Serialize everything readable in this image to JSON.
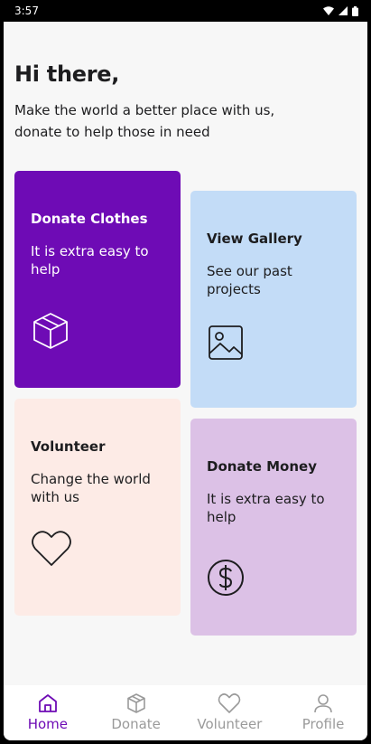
{
  "status_bar": {
    "time": "3:57"
  },
  "header": {
    "greeting": "Hi there,",
    "subtitle": "Make the world a better place with us, donate to help those in need"
  },
  "cards": {
    "donate_clothes": {
      "title": "Donate Clothes",
      "description": "It is extra easy to help",
      "icon": "box-icon"
    },
    "view_gallery": {
      "title": "View Gallery",
      "description": "See our past projects",
      "icon": "image-icon"
    },
    "volunteer": {
      "title": "Volunteer",
      "description": "Change the world with us",
      "icon": "heart-icon"
    },
    "donate_money": {
      "title": "Donate Money",
      "description": "It is extra easy to help",
      "icon": "dollar-icon"
    }
  },
  "bottom_nav": {
    "items": [
      {
        "label": "Home",
        "icon": "home-icon",
        "active": true
      },
      {
        "label": "Donate",
        "icon": "box-icon",
        "active": false
      },
      {
        "label": "Volunteer",
        "icon": "heart-icon",
        "active": false
      },
      {
        "label": "Profile",
        "icon": "user-icon",
        "active": false
      }
    ]
  },
  "colors": {
    "accent": "#6e0bb5",
    "gallery_card": "#c3dcf7",
    "volunteer_card": "#fdebe6",
    "money_card": "#dcc1e6",
    "background": "#f7f7f7"
  }
}
